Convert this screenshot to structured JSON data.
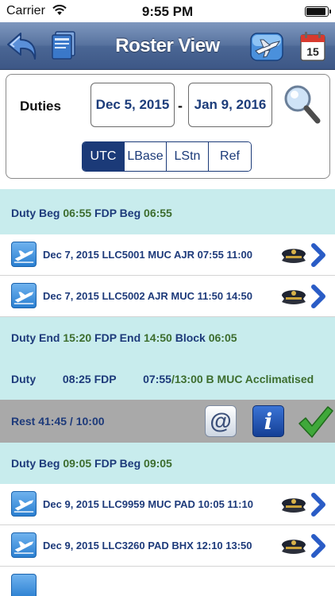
{
  "status_bar": {
    "carrier": "Carrier",
    "time": "9:55 PM"
  },
  "nav": {
    "title": "Roster View"
  },
  "filter": {
    "label": "Duties",
    "start_date": "Dec 5, 2015",
    "separator": "-",
    "end_date": "Jan 9, 2016",
    "timezones": [
      {
        "label": "UTC",
        "selected": true
      },
      {
        "label": "LBase",
        "selected": false
      },
      {
        "label": "LStn",
        "selected": false
      },
      {
        "label": "Ref",
        "selected": false
      }
    ]
  },
  "roster": {
    "duty1_begin": {
      "duty_label": "Duty Beg",
      "duty_time": "06:55",
      "fdp_label": "FDP Beg",
      "fdp_time": "06:55"
    },
    "flights1": [
      {
        "text": "Dec 7, 2015 LLC5001 MUC AJR 07:55 11:00"
      },
      {
        "text": "Dec 7, 2015 LLC5002 AJR MUC 11:50 14:50"
      }
    ],
    "duty1_end": {
      "duty_label": "Duty End",
      "duty_time": "15:20",
      "fdp_label": "FDP End",
      "fdp_time": "14:50",
      "block_label": "Block",
      "block_time": "06:05"
    },
    "duty1_summary": {
      "duty_label": "Duty",
      "duty_value": "08:25 FDP",
      "fdp_value": "07:55",
      "fdp_max": "/13:00",
      "note": "B MUC Acclimatised"
    },
    "rest": {
      "text": "Rest 41:45 / 10:00"
    },
    "duty2_begin": {
      "duty_label": "Duty Beg",
      "duty_time": "09:05",
      "fdp_label": "FDP Beg",
      "fdp_time": "09:05"
    },
    "flights2": [
      {
        "text": "Dec 9, 2015 LLC9959 MUC PAD 10:05 11:10"
      },
      {
        "text": "Dec 9, 2015 LLC3260 PAD BHX 12:10 13:50"
      }
    ]
  },
  "colors": {
    "navy": "#1b3a78",
    "duty_row": "#c8eced",
    "rest_row": "#a9a9a9",
    "time_green": "#3d6d2e"
  }
}
